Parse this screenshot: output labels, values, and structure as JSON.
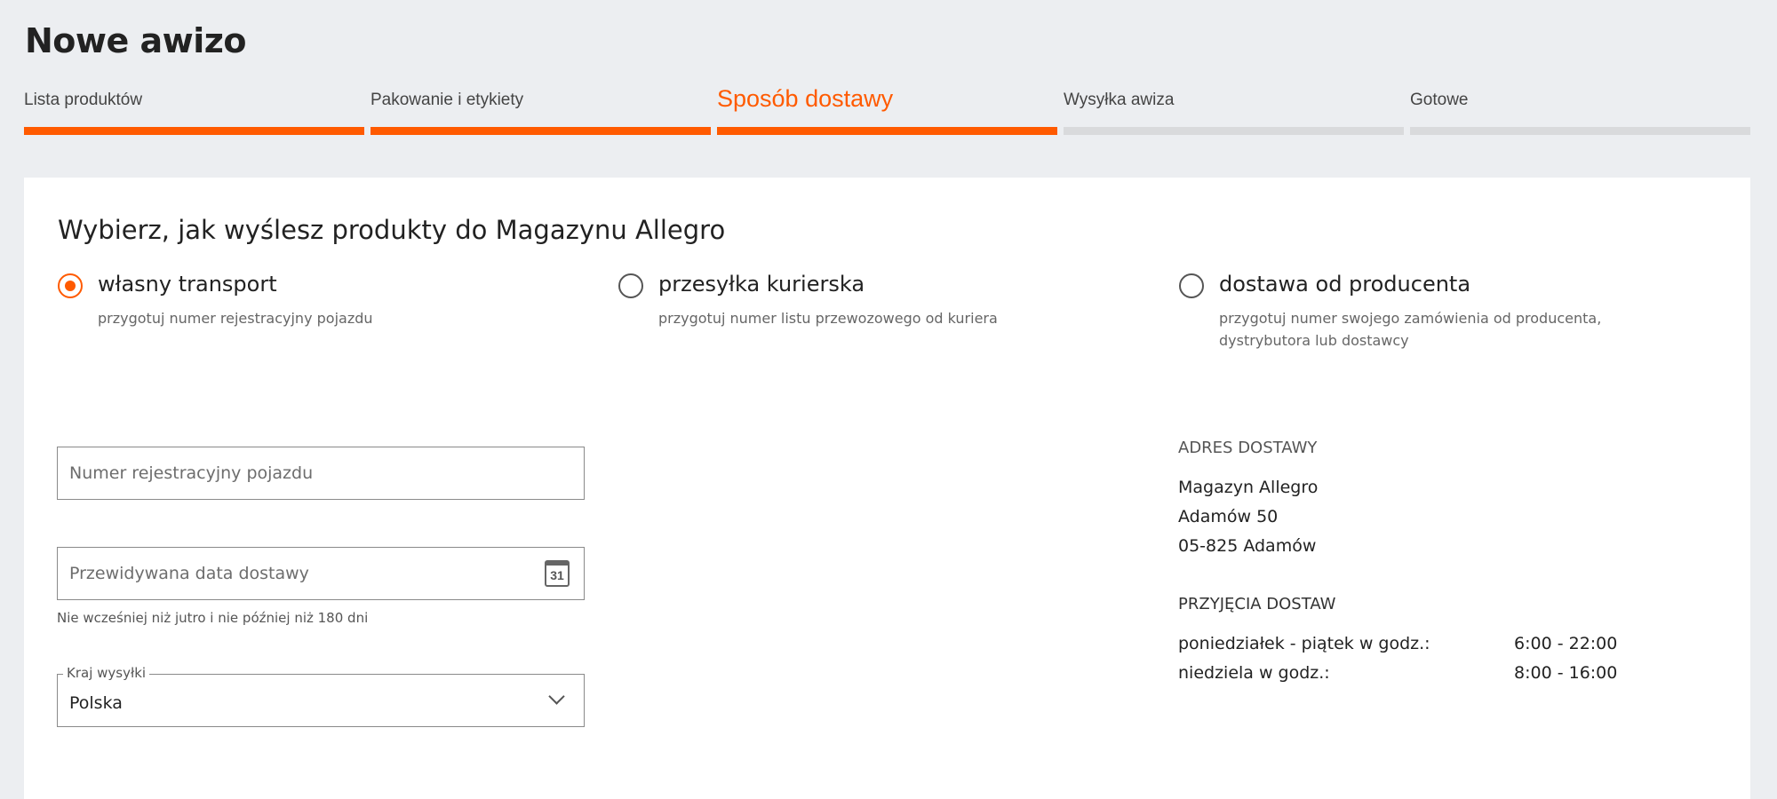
{
  "page": {
    "title": "Nowe awizo"
  },
  "steps": [
    {
      "label": "Lista produktów",
      "state": "done"
    },
    {
      "label": "Pakowanie i etykiety",
      "state": "done"
    },
    {
      "label": "Sposób dostawy",
      "state": "active"
    },
    {
      "label": "Wysyłka awiza",
      "state": "pending"
    },
    {
      "label": "Gotowe",
      "state": "pending"
    }
  ],
  "delivery": {
    "heading": "Wybierz, jak wyślesz produkty do Magazynu Allegro",
    "options": [
      {
        "label": "własny transport",
        "hint": "przygotuj numer rejestracyjny pojazdu",
        "checked": true
      },
      {
        "label": "przesyłka kurierska",
        "hint": "przygotuj numer listu przewozowego od kuriera",
        "checked": false
      },
      {
        "label": "dostawa od producenta",
        "hint": "przygotuj numer swojego zamówienia od producenta, dystrybutora lub dostawcy",
        "checked": false
      }
    ]
  },
  "form": {
    "plate_placeholder": "Numer rejestracyjny pojazdu",
    "date_placeholder": "Przewidywana data dostawy",
    "calendar_icon_text": "31",
    "date_helper": "Nie wcześniej niż jutro i nie później niż 180 dni",
    "country_label": "Kraj wysyłki",
    "country_value": "Polska"
  },
  "address": {
    "heading": "ADRES DOSTAWY",
    "lines": [
      "Magazyn Allegro",
      "Adamów 50",
      "05-825 Adamów"
    ],
    "hours_heading": "PRZYJĘCIA DOSTAW",
    "hours": [
      {
        "days": "poniedziałek - piątek w godz.:",
        "time": "6:00 - 22:00"
      },
      {
        "days": "niedziela w godz.:",
        "time": "8:00 - 16:00"
      }
    ]
  },
  "colors": {
    "accent": "#ff5a00",
    "background": "#eceef1",
    "inactive_bar": "#d9dadc"
  }
}
